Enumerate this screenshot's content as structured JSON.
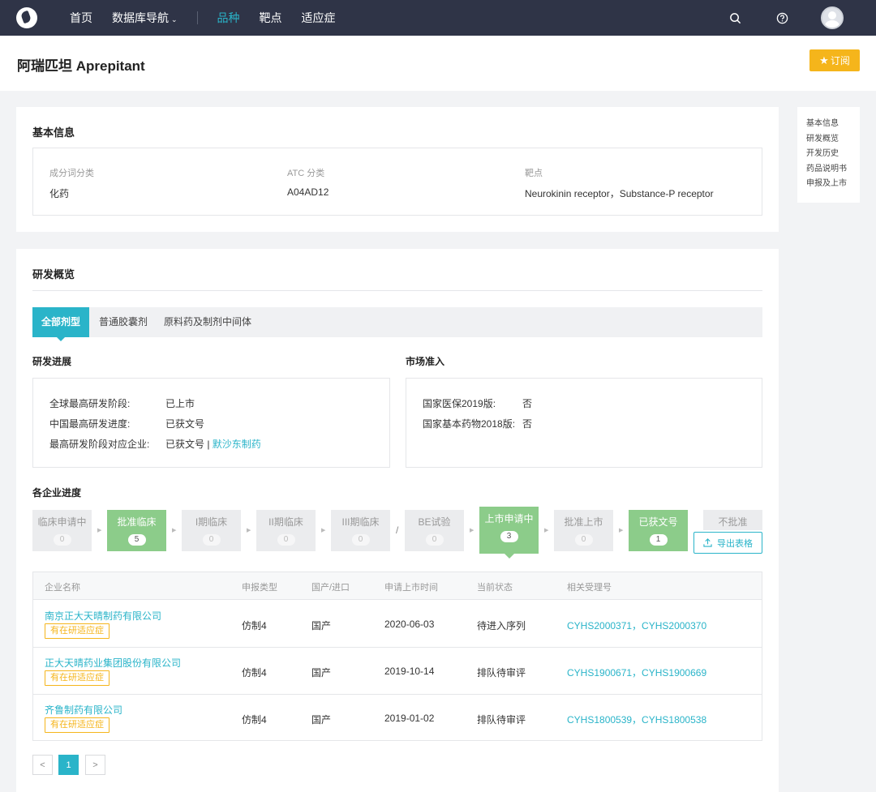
{
  "nav": {
    "items": [
      "首页",
      "数据库导航",
      "品种",
      "靶点",
      "适应症"
    ],
    "active_index": 2
  },
  "header": {
    "title": "阿瑞匹坦 Aprepitant",
    "subscribe_label": "订阅"
  },
  "basic": {
    "section_title": "基本信息",
    "fields": [
      {
        "label": "成分词分类",
        "value": "化药"
      },
      {
        "label": "ATC 分类",
        "value": "A04AD12"
      },
      {
        "label": "靶点",
        "value": "Neurokinin receptor，Substance-P receptor"
      }
    ]
  },
  "rd": {
    "section_title": "研发概览",
    "tabs": [
      "全部剂型",
      "普通胶囊剂",
      "原料药及制剂中间体"
    ],
    "progress": {
      "title": "研发进展",
      "rows": [
        {
          "label": "全球最高研发阶段:",
          "value": "已上市"
        },
        {
          "label": "中国最高研发进度:",
          "value": "已获文号"
        },
        {
          "label": "最高研发阶段对应企业:",
          "value": "已获文号 |",
          "link": "默沙东制药"
        }
      ]
    },
    "market": {
      "title": "市场准入",
      "rows": [
        {
          "label": "国家医保2019版:",
          "value": "否"
        },
        {
          "label": "国家基本药物2018版:",
          "value": "否"
        }
      ]
    },
    "company_progress_title": "各企业进度",
    "stages": [
      {
        "name": "临床申请中",
        "count": "0"
      },
      {
        "name": "批准临床",
        "count": "5"
      },
      {
        "name": "I期临床",
        "count": "0"
      },
      {
        "name": "II期临床",
        "count": "0"
      },
      {
        "name": "III期临床",
        "count": "0"
      },
      {
        "name": "BE试验",
        "count": "0"
      },
      {
        "name": "上市申请中",
        "count": "3"
      },
      {
        "name": "批准上市",
        "count": "0"
      },
      {
        "name": "已获文号",
        "count": "1"
      },
      {
        "name": "不批准"
      }
    ],
    "stage_separator": "/",
    "export_label": "导出表格",
    "table": {
      "headers": [
        "企业名称",
        "申报类型",
        "国产/进口",
        "申请上市时间",
        "当前状态",
        "相关受理号"
      ],
      "rows": [
        {
          "company": "南京正大天晴制药有限公司",
          "tag": "有在研适应症",
          "type": "仿制4",
          "origin": "国产",
          "date": "2020-06-03",
          "status": "待进入序列",
          "codes": "CYHS2000371，CYHS2000370"
        },
        {
          "company": "正大天晴药业集团股份有限公司",
          "tag": "有在研适应症",
          "type": "仿制4",
          "origin": "国产",
          "date": "2019-10-14",
          "status": "排队待审评",
          "codes": "CYHS1900671，CYHS1900669"
        },
        {
          "company": "齐鲁制药有限公司",
          "tag": "有在研适应症",
          "type": "仿制4",
          "origin": "国产",
          "date": "2019-01-02",
          "status": "排队待审评",
          "codes": "CYHS1800539，CYHS1800538"
        }
      ]
    },
    "pagination": {
      "prev": "<",
      "current": "1",
      "next": ">"
    }
  },
  "sidenav": {
    "items": [
      "基本信息",
      "研发概览",
      "开发历史",
      "药品说明书",
      "申报及上市"
    ]
  }
}
